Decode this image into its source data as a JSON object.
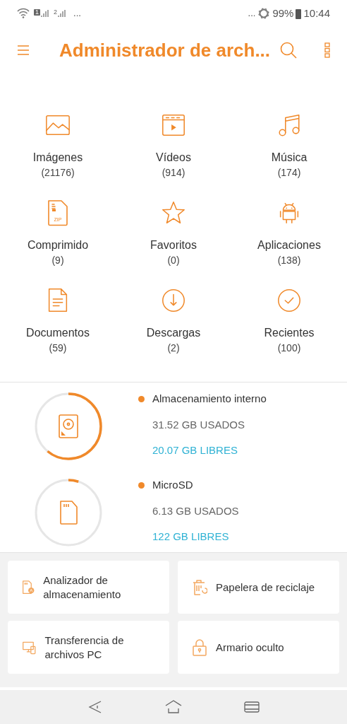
{
  "status_bar": {
    "sim_slots": [
      "1",
      "2"
    ],
    "left_more": "...",
    "right_more": "...",
    "battery": "99%",
    "time": "10:44"
  },
  "header": {
    "title": "Administrador de arch..."
  },
  "categories": [
    {
      "kind": "images",
      "label": "Imágenes",
      "count": "(21176)"
    },
    {
      "kind": "videos",
      "label": "Vídeos",
      "count": "(914)"
    },
    {
      "kind": "music",
      "label": "Música",
      "count": "(174)"
    },
    {
      "kind": "zip",
      "label": "Comprimido",
      "count": "(9)",
      "badge": "ZIP"
    },
    {
      "kind": "favorites",
      "label": "Favoritos",
      "count": "(0)"
    },
    {
      "kind": "apps",
      "label": "Aplicaciones",
      "count": "(138)"
    },
    {
      "kind": "documents",
      "label": "Documentos",
      "count": "(59)"
    },
    {
      "kind": "downloads",
      "label": "Descargas",
      "count": "(2)"
    },
    {
      "kind": "recent",
      "label": "Recientes",
      "count": "(100)"
    }
  ],
  "storage": [
    {
      "kind": "internal",
      "name": "Almacenamiento interno",
      "used": "31.52 GB USADOS",
      "free": "20.07 GB LIBRES",
      "color": "#f0892a"
    },
    {
      "kind": "sd",
      "name": "MicroSD",
      "used": "6.13 GB USADOS",
      "free": "122 GB LIBRES",
      "color": "#f0892a"
    }
  ],
  "tools": [
    {
      "kind": "analyzer",
      "label": "Analizador de almacenamiento"
    },
    {
      "kind": "recycle",
      "label": "Papelera de reciclaje"
    },
    {
      "kind": "transfer",
      "label": "Transferencia de archivos PC"
    },
    {
      "kind": "locker",
      "label": "Armario oculto"
    }
  ]
}
